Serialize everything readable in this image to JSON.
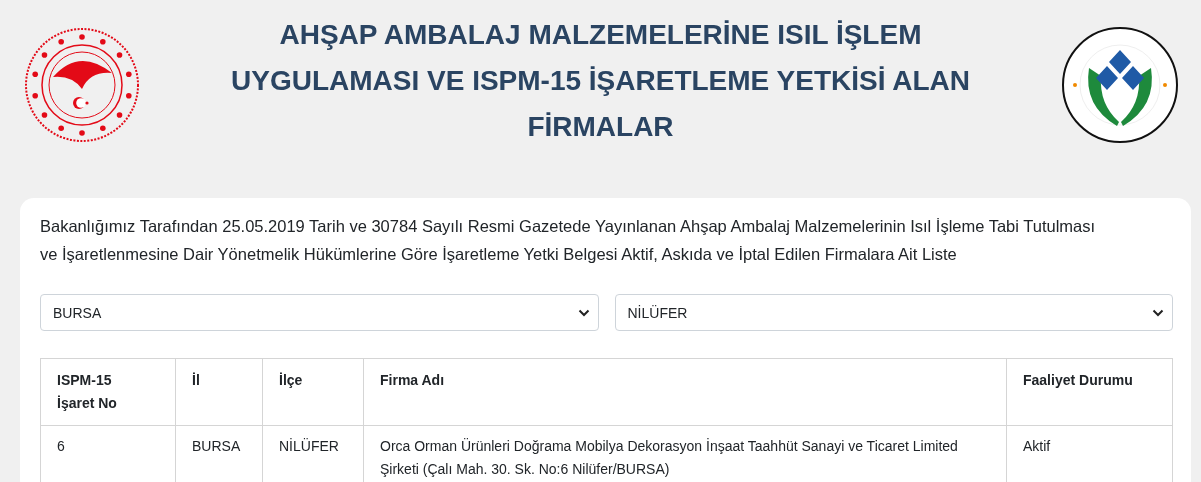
{
  "header": {
    "title_lines": [
      "AHŞAP AMBALAJ MALZEMELERİNE ISIL İŞLEM",
      "UYGULAMASI VE ISPM-15 İŞARETLEME YETKİSİ ALAN",
      "FİRMALAR"
    ]
  },
  "card": {
    "description": "Bakanlığımız Tarafından 25.05.2019 Tarih ve 30784 Sayılı Resmi Gazetede Yayınlanan Ahşap Ambalaj Malzemelerinin Isıl İşleme Tabi Tutulması ve İşaretlenmesine Dair Yönetmelik Hükümlerine Göre İşaretleme Yetki Belgesi Aktif, Askıda ve İptal Edilen Firmalara Ait Liste",
    "filters": [
      {
        "value": "BURSA"
      },
      {
        "value": "NİLÜFER"
      }
    ],
    "table": {
      "columns": [
        "ISPM-15 İşaret No",
        "İl",
        "İlçe",
        "Firma Adı",
        "Faaliyet Durumu"
      ],
      "rows": [
        [
          "6",
          "BURSA",
          "NİLÜFER",
          "Orca Orman Ürünleri Doğrama Mobilya Dekorasyon İnşaat Taahhüt Sanayi ve Ticaret Limited Şirketi (Çalı Mah. 30. Sk. No:6 Nilüfer/BURSA)",
          "Aktif"
        ]
      ]
    }
  }
}
